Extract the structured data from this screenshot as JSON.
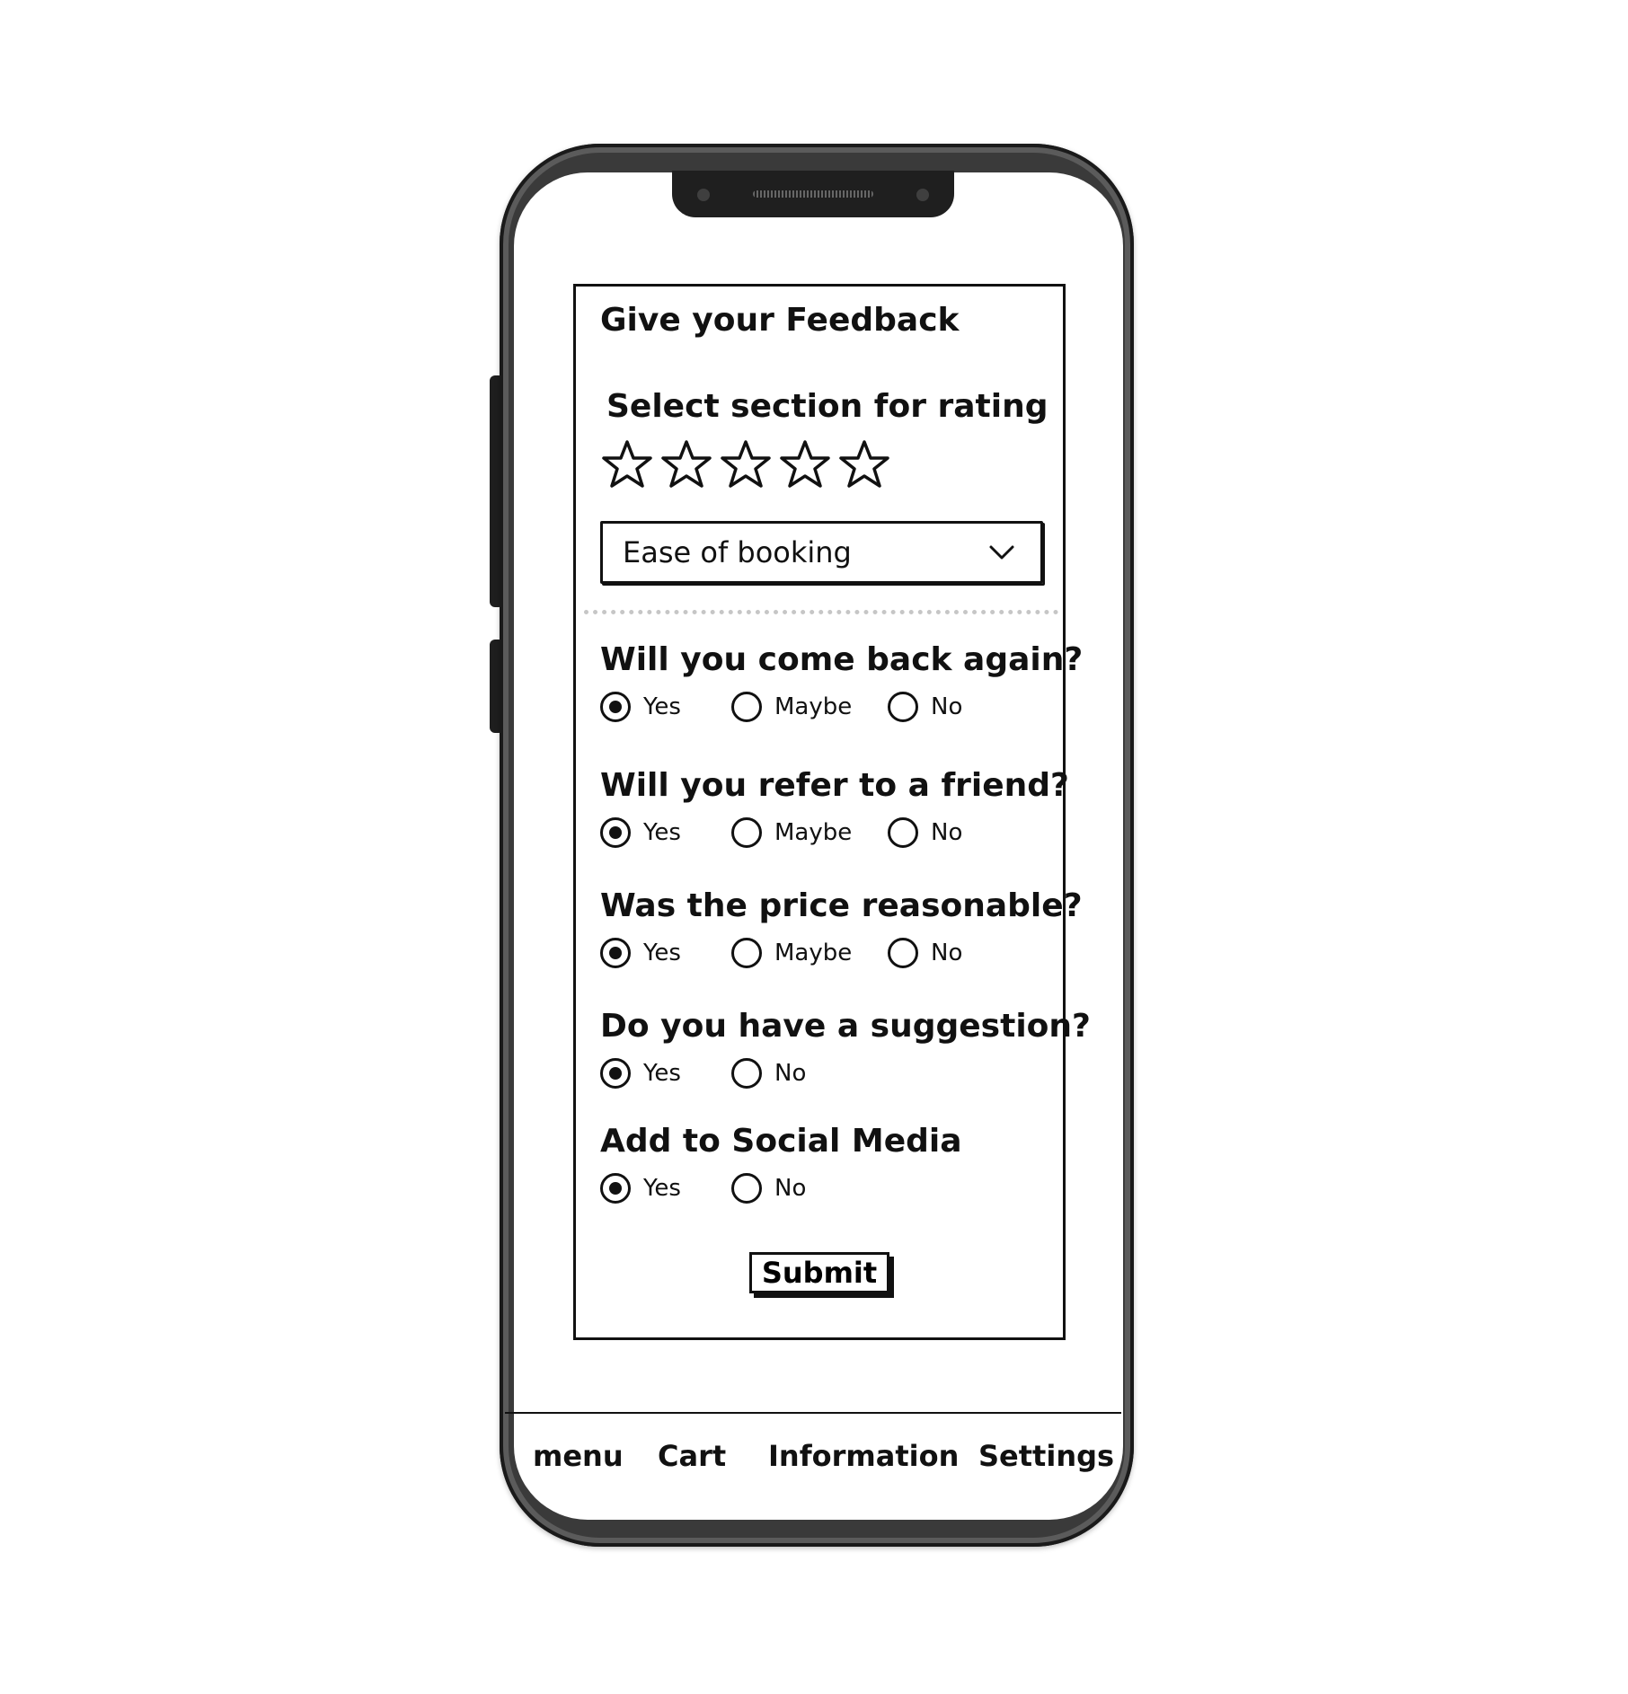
{
  "feedback": {
    "title": "Give your Feedback",
    "rating_label": "Select section for rating",
    "stars_total": 5,
    "stars_filled": 0,
    "dropdown_value": "Ease of booking",
    "questions": [
      {
        "text": "Will you come back again?",
        "options": [
          "Yes",
          "Maybe",
          "No"
        ],
        "selected": "Yes"
      },
      {
        "text": "Will you refer to a friend?",
        "options": [
          "Yes",
          "Maybe",
          "No"
        ],
        "selected": "Yes"
      },
      {
        "text": "Was the price reasonable?",
        "options": [
          "Yes",
          "Maybe",
          "No"
        ],
        "selected": "Yes"
      },
      {
        "text": "Do you have a suggestion?",
        "options": [
          "Yes",
          "No"
        ],
        "selected": "Yes"
      },
      {
        "text": "Add to Social Media",
        "options": [
          "Yes",
          "No"
        ],
        "selected": "Yes"
      }
    ],
    "submit_label": "Submit"
  },
  "nav": {
    "items": [
      "menu",
      "Cart",
      "Information",
      "Settings"
    ]
  },
  "icons": {
    "star": "star-outline-icon",
    "dropdown": "chevron-down-icon"
  },
  "colors": {
    "ink": "#111111",
    "frame": "#3a3a3a",
    "divider": "#c6c6c6"
  }
}
